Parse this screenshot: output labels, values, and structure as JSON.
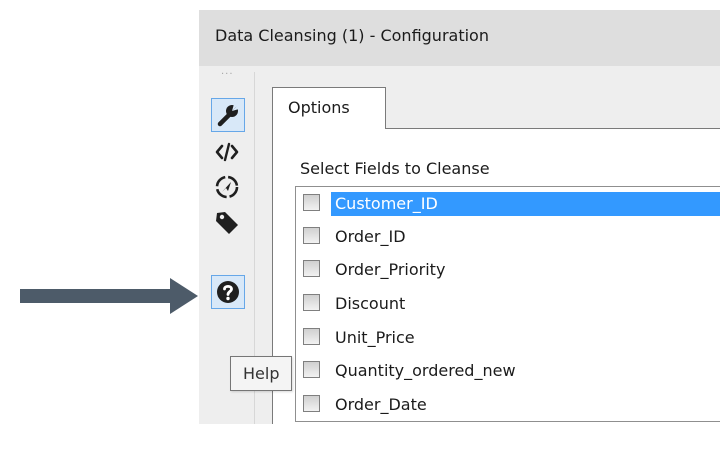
{
  "window": {
    "title": "Data Cleansing (1) - Configuration"
  },
  "toolbar": {
    "grip": "···",
    "tools": [
      {
        "name": "wrench-icon",
        "active": true
      },
      {
        "name": "code-icon",
        "active": false
      },
      {
        "name": "compass-icon",
        "active": false
      },
      {
        "name": "tag-icon",
        "active": false
      },
      {
        "name": "help-icon",
        "active": true
      }
    ]
  },
  "tabs": [
    {
      "label": "Options",
      "selected": true
    }
  ],
  "options": {
    "fields_label": "Select Fields to Cleanse",
    "fields": [
      {
        "label": "Customer_ID",
        "checked": false,
        "selected": true
      },
      {
        "label": "Order_ID",
        "checked": false,
        "selected": false
      },
      {
        "label": "Order_Priority",
        "checked": false,
        "selected": false
      },
      {
        "label": "Discount",
        "checked": false,
        "selected": false
      },
      {
        "label": "Unit_Price",
        "checked": false,
        "selected": false
      },
      {
        "label": "Quantity_ordered_new",
        "checked": false,
        "selected": false
      },
      {
        "label": "Order_Date",
        "checked": false,
        "selected": false
      }
    ]
  },
  "tooltip": {
    "text": "Help"
  },
  "colors": {
    "selection": "#3399ff",
    "active_tool_border": "#66a7e8",
    "arrow": "#4d5b69"
  }
}
